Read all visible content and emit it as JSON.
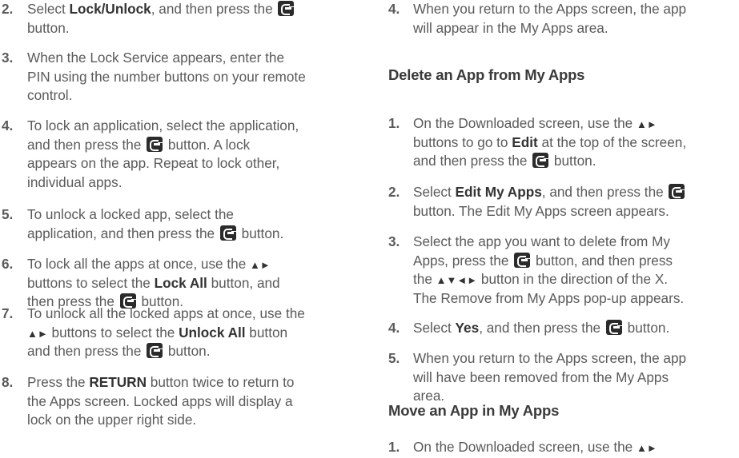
{
  "left_steps": [
    {
      "num": "2.",
      "lines": [
        [
          {
            "t": "Select "
          },
          {
            "b": "Lock/Unlock"
          },
          {
            "t": ", and then press the "
          },
          {
            "icon": "enter"
          }
        ],
        [
          {
            "t": "button."
          }
        ]
      ]
    },
    {
      "num": "3.",
      "lines": [
        [
          {
            "t": "When the Lock Service appears, enter the"
          }
        ],
        [
          {
            "t": "PIN using the number buttons on your remote"
          }
        ],
        [
          {
            "t": "control."
          }
        ]
      ]
    },
    {
      "num": "4.",
      "lines": [
        [
          {
            "t": "To lock an application, select the application,"
          }
        ],
        [
          {
            "t": "and then press the "
          },
          {
            "icon": "enter"
          },
          {
            "t": " button. A lock"
          }
        ],
        [
          {
            "t": "appears on the app. Repeat to lock other,"
          }
        ],
        [
          {
            "t": "individual apps."
          }
        ]
      ]
    },
    {
      "num": "5.",
      "lines": [
        [
          {
            "t": "To unlock a locked app, select the"
          }
        ],
        [
          {
            "t": "application, and then press the "
          },
          {
            "icon": "enter"
          },
          {
            "t": " button."
          }
        ]
      ]
    },
    {
      "num": "6.",
      "lines": [
        [
          {
            "t": "To lock all the apps at once, use the "
          },
          {
            "arrows": "▲►"
          }
        ],
        [
          {
            "t": "buttons to select the "
          },
          {
            "b": "Lock All"
          },
          {
            "t": " button, and"
          }
        ],
        [
          {
            "t": "then press the "
          },
          {
            "icon": "enter"
          },
          {
            "t": " button."
          }
        ]
      ]
    },
    {
      "num": "7.",
      "lines": [
        [
          {
            "t": "To unlock all the locked apps at once, use the"
          }
        ],
        [
          {
            "arrows": "▲►"
          },
          {
            "t": " buttons to select the "
          },
          {
            "b": "Unlock All"
          },
          {
            "t": " button"
          }
        ],
        [
          {
            "t": "and then press the "
          },
          {
            "icon": "enter"
          },
          {
            "t": " button."
          }
        ]
      ]
    },
    {
      "num": "8.",
      "lines": [
        [
          {
            "t": "Press the "
          },
          {
            "b": "RETURN"
          },
          {
            "t": " button twice to return to"
          }
        ],
        [
          {
            "t": "the Apps screen. Locked apps will display a"
          }
        ],
        [
          {
            "t": "lock on the upper right side."
          }
        ]
      ]
    }
  ],
  "right_top_step": {
    "num": "4.",
    "lines": [
      [
        {
          "t": "When you return to the Apps screen, the app"
        }
      ],
      [
        {
          "t": "will appear in the My Apps area."
        }
      ]
    ]
  },
  "delete_heading": "Delete an App from My Apps",
  "delete_steps": [
    {
      "num": "1.",
      "lines": [
        [
          {
            "t": "On the Downloaded screen, use the "
          },
          {
            "arrows": "▲►"
          }
        ],
        [
          {
            "t": "buttons to go to "
          },
          {
            "b": "Edit"
          },
          {
            "t": " at the top of the screen,"
          }
        ],
        [
          {
            "t": "and then press the "
          },
          {
            "icon": "enter"
          },
          {
            "t": " button."
          }
        ]
      ]
    },
    {
      "num": "2.",
      "lines": [
        [
          {
            "t": "Select "
          },
          {
            "b": "Edit My Apps"
          },
          {
            "t": ", and then press the "
          },
          {
            "icon": "enter"
          }
        ],
        [
          {
            "t": "button. The Edit My Apps screen appears."
          }
        ]
      ]
    },
    {
      "num": "3.",
      "lines": [
        [
          {
            "t": "Select the app you want to delete from My"
          }
        ],
        [
          {
            "t": "Apps, press the "
          },
          {
            "icon": "enter"
          },
          {
            "t": " button, and then press"
          }
        ],
        [
          {
            "t": "the "
          },
          {
            "arrows": "▲▼◄►"
          },
          {
            "t": " button in the direction of the X."
          }
        ],
        [
          {
            "t": "The Remove from My Apps pop-up appears."
          }
        ]
      ]
    },
    {
      "num": "4.",
      "lines": [
        [
          {
            "t": "Select "
          },
          {
            "b": "Yes"
          },
          {
            "t": ", and then press the "
          },
          {
            "icon": "enter"
          },
          {
            "t": " button."
          }
        ]
      ]
    },
    {
      "num": "5.",
      "lines": [
        [
          {
            "t": "When you return to the Apps screen, the app"
          }
        ],
        [
          {
            "t": "will have been removed from the My Apps"
          }
        ],
        [
          {
            "t": "area."
          }
        ]
      ]
    }
  ],
  "move_heading": "Move an App in My Apps",
  "move_steps": [
    {
      "num": "1.",
      "lines": [
        [
          {
            "t": "On the Downloaded screen, use the "
          },
          {
            "arrows": "▲►"
          }
        ]
      ]
    }
  ]
}
